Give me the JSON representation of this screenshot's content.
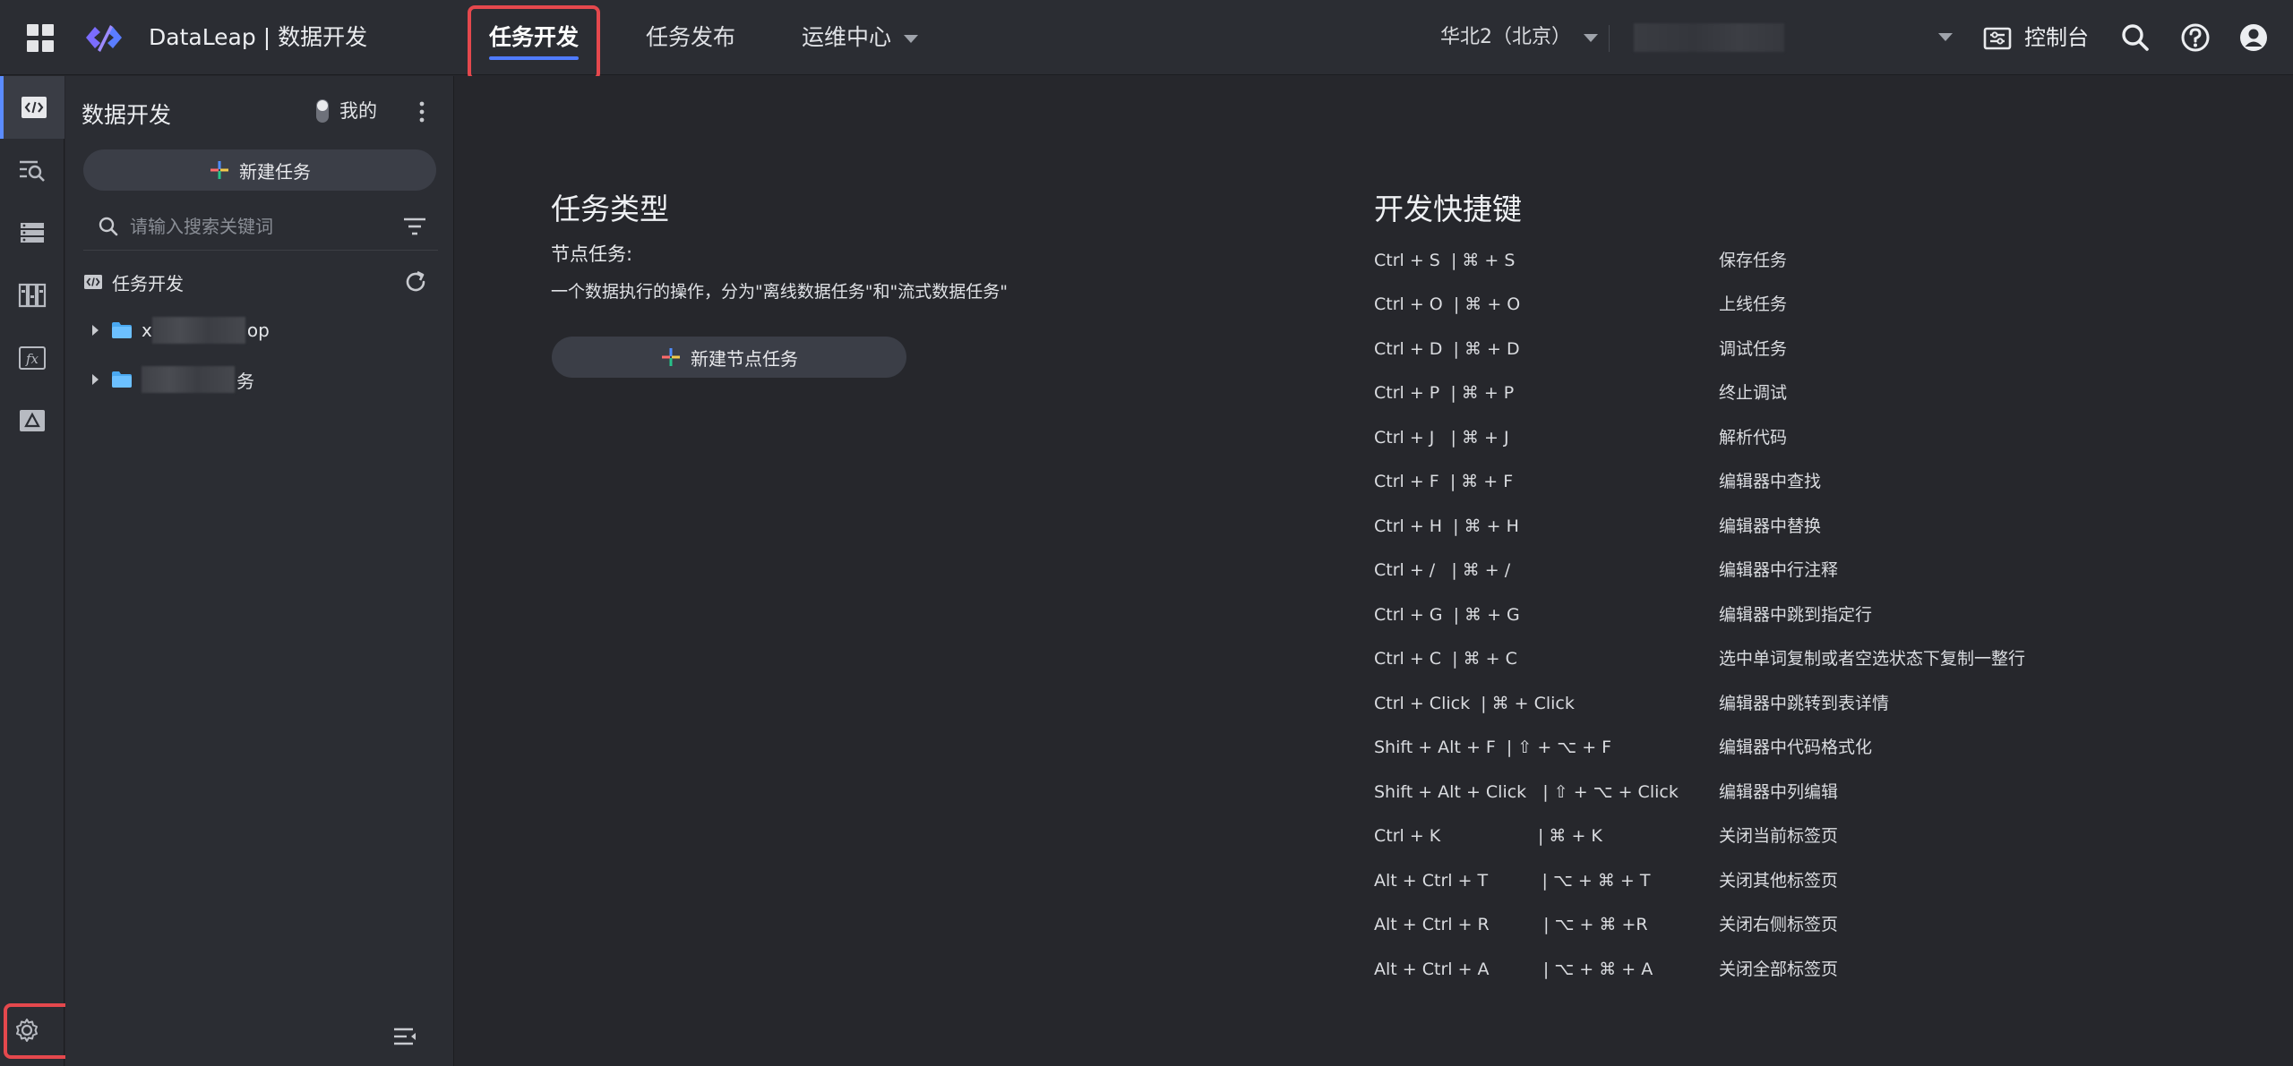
{
  "topbar": {
    "app_title": "DataLeap | 数据开发",
    "tabs": [
      {
        "label": "任务开发",
        "active": true
      },
      {
        "label": "任务发布",
        "active": false
      },
      {
        "label": "运维中心",
        "active": false
      }
    ],
    "region": "华北2（北京）",
    "console_label": "控制台",
    "accent_color": "#4f7bff",
    "highlight_color": "#e5484d"
  },
  "rail": {
    "items": [
      "code-icon",
      "query-icon",
      "database-icon",
      "library-icon",
      "function-icon",
      "cloud-drive-icon"
    ],
    "settings_icon": "gear-icon"
  },
  "panel": {
    "title": "数据开发",
    "toggle_label": "我的",
    "new_task_label": "新建任务",
    "search_placeholder": "请输入搜索关键词",
    "tree_header": "任务开发",
    "tree_items": [
      {
        "prefix": "x",
        "suffix": "op"
      },
      {
        "prefix": "",
        "suffix": "务"
      }
    ]
  },
  "main": {
    "task_types_title": "任务类型",
    "node_task_label": "节点任务:",
    "node_task_desc": "一个数据执行的操作，分为\"离线数据任务\"和\"流式数据任务\"",
    "new_node_task_label": "新建节点任务",
    "shortcuts_title": "开发快捷键",
    "shortcuts": [
      {
        "keys": "Ctrl + S  | ⌘ + S",
        "desc": "保存任务"
      },
      {
        "keys": "Ctrl + O  | ⌘ + O",
        "desc": "上线任务"
      },
      {
        "keys": "Ctrl + D  | ⌘ + D",
        "desc": "调试任务"
      },
      {
        "keys": "Ctrl + P  | ⌘ + P",
        "desc": "终止调试"
      },
      {
        "keys": "Ctrl + J   | ⌘ + J",
        "desc": "解析代码"
      },
      {
        "keys": "Ctrl + F  | ⌘ + F",
        "desc": "编辑器中查找"
      },
      {
        "keys": "Ctrl + H  | ⌘ + H",
        "desc": "编辑器中替换"
      },
      {
        "keys": "Ctrl + /   | ⌘ + /",
        "desc": "编辑器中行注释"
      },
      {
        "keys": "Ctrl + G  | ⌘ + G",
        "desc": "编辑器中跳到指定行"
      },
      {
        "keys": "Ctrl + C  | ⌘ + C",
        "desc": "选中单词复制或者空选状态下复制一整行"
      },
      {
        "keys": "Ctrl + Click  | ⌘ + Click",
        "desc": "编辑器中跳转到表详情"
      },
      {
        "keys": "Shift + Alt + F  | ⇧ + ⌥ + F",
        "desc": "编辑器中代码格式化"
      },
      {
        "keys": "Shift + Alt + Click   | ⇧ + ⌥ + Click",
        "desc": "编辑器中列编辑"
      },
      {
        "keys": "Ctrl + K                  | ⌘ + K",
        "desc": "关闭当前标签页"
      },
      {
        "keys": "Alt + Ctrl + T          | ⌥ + ⌘ + T",
        "desc": "关闭其他标签页"
      },
      {
        "keys": "Alt + Ctrl + R          | ⌥ + ⌘ +R",
        "desc": "关闭右侧标签页"
      },
      {
        "keys": "Alt + Ctrl + A          | ⌥ + ⌘ + A",
        "desc": "关闭全部标签页"
      }
    ]
  }
}
